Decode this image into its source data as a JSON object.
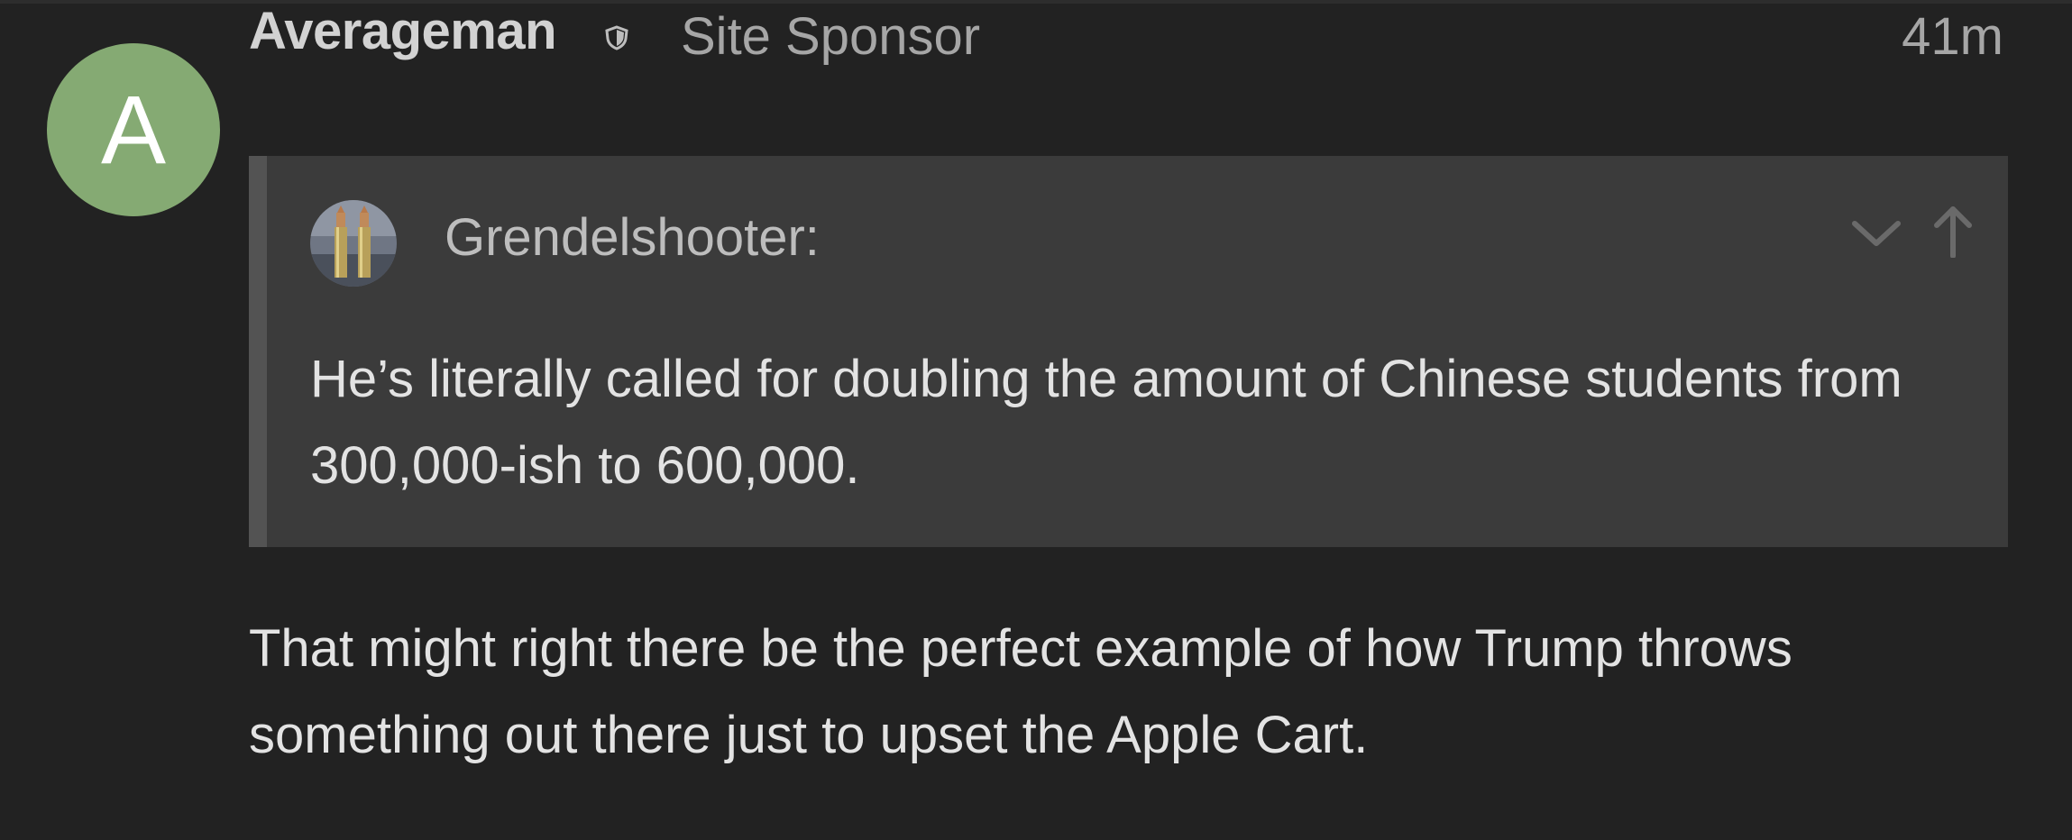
{
  "post": {
    "avatar_letter": "A",
    "avatar_color": "#85aa73",
    "username": "Averageman",
    "user_icon": "shield-icon",
    "user_title": "Site Sponsor",
    "time": "41m",
    "quote": {
      "author": "Grendelshooter:",
      "avatar_icon": "rifle-cartridges-avatar",
      "expand_icon": "chevron-down-icon",
      "goto_icon": "arrow-up-icon",
      "text": "He’s literally called for doubling the amount of Chinese students from 300,000-ish to 600,000."
    },
    "body": "That might right there be the perfect example of how Trump throws something out there just to upset the Apple Cart."
  }
}
